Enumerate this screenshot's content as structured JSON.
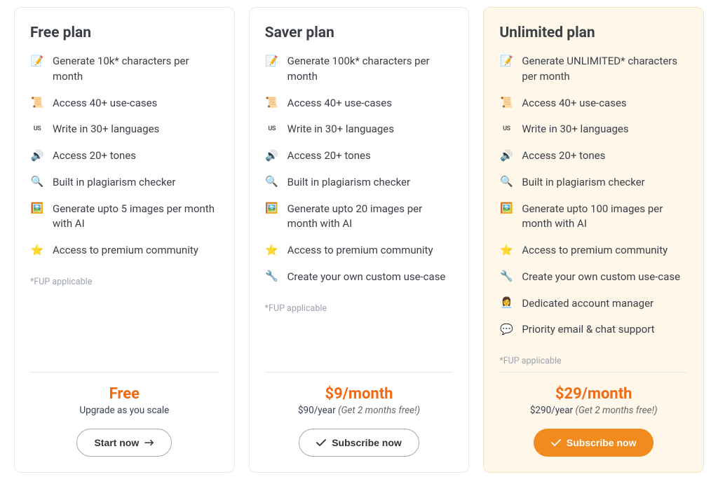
{
  "plans": [
    {
      "title": "Free plan",
      "features": [
        {
          "icon": "📝",
          "icon_name": "document-icon",
          "label": "Generate 10k* characters per month"
        },
        {
          "icon": "📜",
          "icon_name": "scroll-icon",
          "label": "Access 40+ use-cases"
        },
        {
          "icon": "US",
          "icon_name": "flag-us-icon",
          "label": "Write in 30+ languages"
        },
        {
          "icon": "🔊",
          "icon_name": "speaker-icon",
          "label": "Access 20+ tones"
        },
        {
          "icon": "🔍",
          "icon_name": "magnifier-icon",
          "label": "Built in plagiarism checker"
        },
        {
          "icon": "🖼️",
          "icon_name": "image-icon",
          "label": "Generate upto 5 images per month with AI"
        },
        {
          "icon": "⭐",
          "icon_name": "star-icon",
          "label": "Access to premium community"
        }
      ],
      "fup_note": "*FUP applicable",
      "price_main": "Free",
      "price_sub": "Upgrade as you scale",
      "price_sub_italic": "",
      "cta_label": "Start now",
      "cta_style": "outline",
      "cta_icon": "arrow"
    },
    {
      "title": "Saver plan",
      "features": [
        {
          "icon": "📝",
          "icon_name": "document-icon",
          "label": "Generate 100k* characters per month"
        },
        {
          "icon": "📜",
          "icon_name": "scroll-icon",
          "label": "Access 40+ use-cases"
        },
        {
          "icon": "US",
          "icon_name": "flag-us-icon",
          "label": "Write in 30+ languages"
        },
        {
          "icon": "🔊",
          "icon_name": "speaker-icon",
          "label": "Access 20+ tones"
        },
        {
          "icon": "🔍",
          "icon_name": "magnifier-icon",
          "label": "Built in plagiarism checker"
        },
        {
          "icon": "🖼️",
          "icon_name": "image-icon",
          "label": "Generate upto 20 images per month with AI"
        },
        {
          "icon": "⭐",
          "icon_name": "star-icon",
          "label": "Access to premium community"
        },
        {
          "icon": "🔧",
          "icon_name": "wrench-icon",
          "label": "Create your own custom use-case"
        }
      ],
      "fup_note": "*FUP applicable",
      "price_main": "$9/month",
      "price_sub": "$90/year ",
      "price_sub_italic": "(Get 2 months free!)",
      "cta_label": "Subscribe now",
      "cta_style": "outline",
      "cta_icon": "check"
    },
    {
      "title": "Unlimited plan",
      "features": [
        {
          "icon": "📝",
          "icon_name": "document-icon",
          "label": "Generate UNLIMITED* characters per month"
        },
        {
          "icon": "📜",
          "icon_name": "scroll-icon",
          "label": "Access 40+ use-cases"
        },
        {
          "icon": "US",
          "icon_name": "flag-us-icon",
          "label": "Write in 30+ languages"
        },
        {
          "icon": "🔊",
          "icon_name": "speaker-icon",
          "label": "Access 20+ tones"
        },
        {
          "icon": "🔍",
          "icon_name": "magnifier-icon",
          "label": "Built in plagiarism checker"
        },
        {
          "icon": "🖼️",
          "icon_name": "image-icon",
          "label": "Generate upto 100 images per month with AI"
        },
        {
          "icon": "⭐",
          "icon_name": "star-icon",
          "label": "Access to premium community"
        },
        {
          "icon": "🔧",
          "icon_name": "wrench-icon",
          "label": "Create your own custom use-case"
        },
        {
          "icon": "👩‍💼",
          "icon_name": "manager-icon",
          "label": "Dedicated account manager"
        },
        {
          "icon": "💬",
          "icon_name": "chat-icon",
          "label": "Priority email & chat support"
        }
      ],
      "fup_note": "*FUP applicable",
      "price_main": "$29/month",
      "price_sub": "$290/year ",
      "price_sub_italic": "(Get 2 months free!)",
      "cta_label": "Subscribe now",
      "cta_style": "primary",
      "cta_icon": "check",
      "highlighted": true
    }
  ]
}
